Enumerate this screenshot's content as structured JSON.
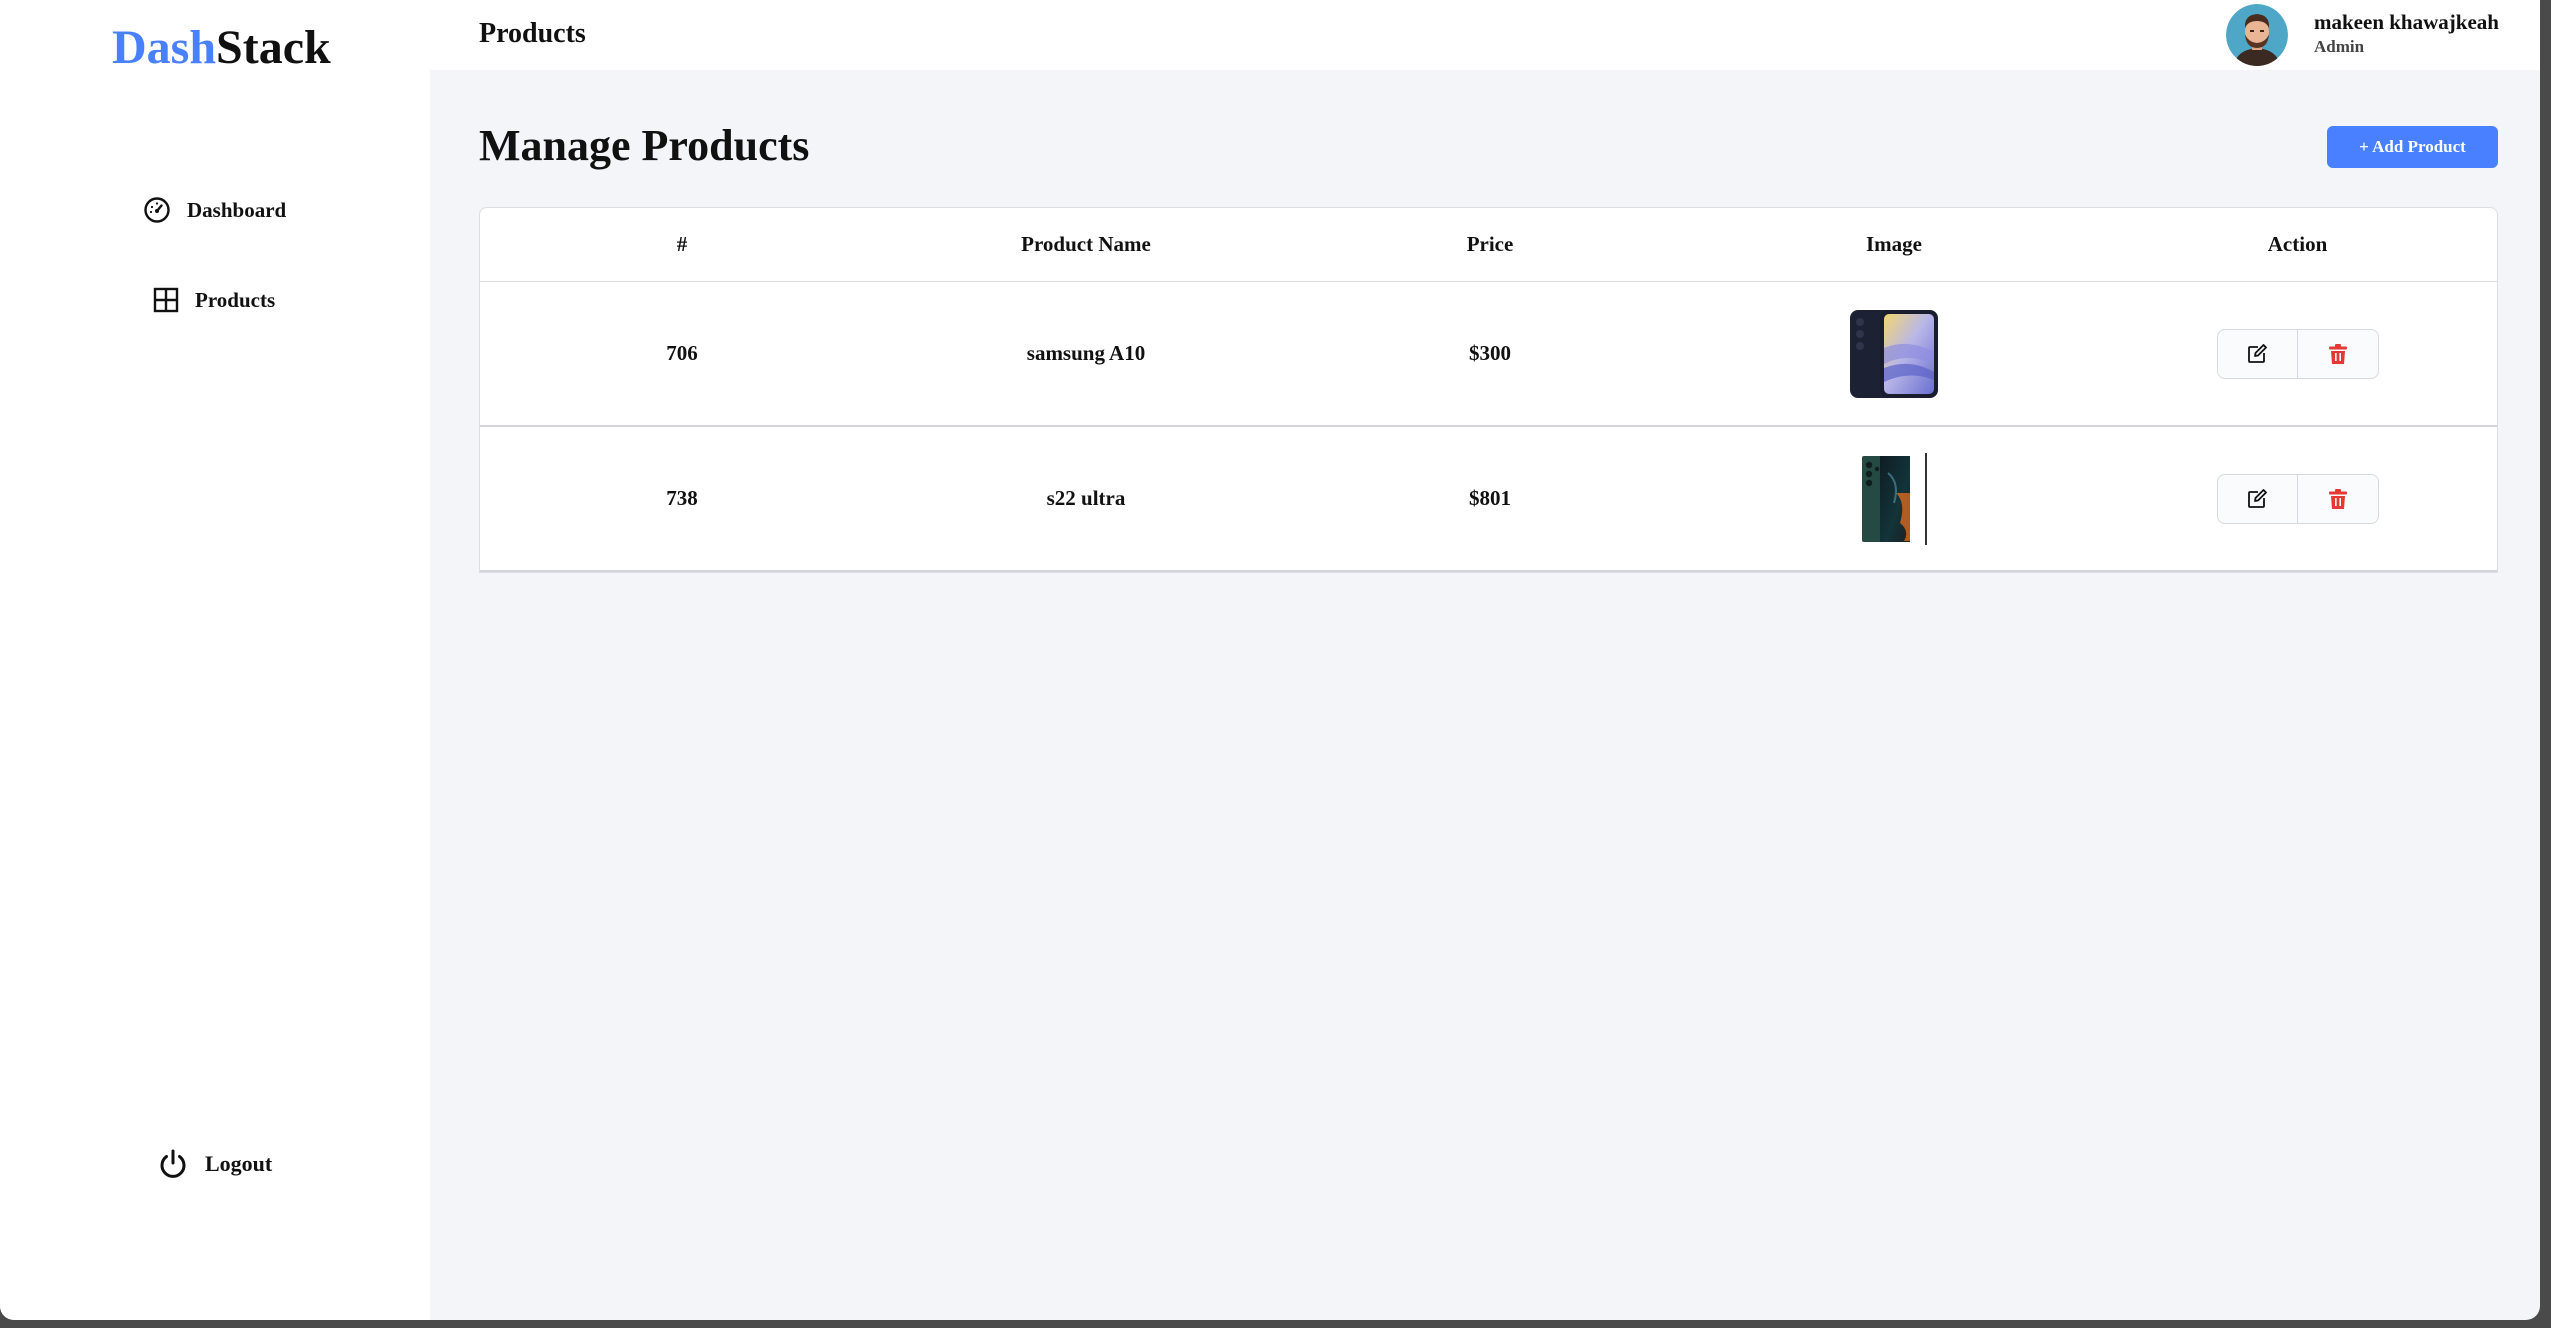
{
  "brand": {
    "part1": "Dash",
    "part2": "Stack"
  },
  "sidebar": {
    "items": [
      {
        "label": "Dashboard",
        "icon": "speedometer-icon"
      },
      {
        "label": "Products",
        "icon": "grid-icon"
      }
    ],
    "logout": {
      "label": "Logout",
      "icon": "power-icon"
    }
  },
  "header": {
    "title": "Products",
    "user": {
      "name": "makeen khawajkeah",
      "role": "Admin"
    }
  },
  "main": {
    "heading": "Manage Products",
    "add_button": "+ Add Product",
    "table": {
      "columns": [
        "#",
        "Product Name",
        "Price",
        "Image",
        "Action"
      ],
      "rows": [
        {
          "id": "706",
          "name": "samsung A10",
          "price": "$300",
          "image": "phone-blue-yellow-image"
        },
        {
          "id": "738",
          "name": "s22 ultra",
          "price": "$801",
          "image": "phone-green-image"
        }
      ]
    }
  },
  "colors": {
    "accent": "#4880ff",
    "delete": "#e53935",
    "background": "#f4f5f8"
  }
}
